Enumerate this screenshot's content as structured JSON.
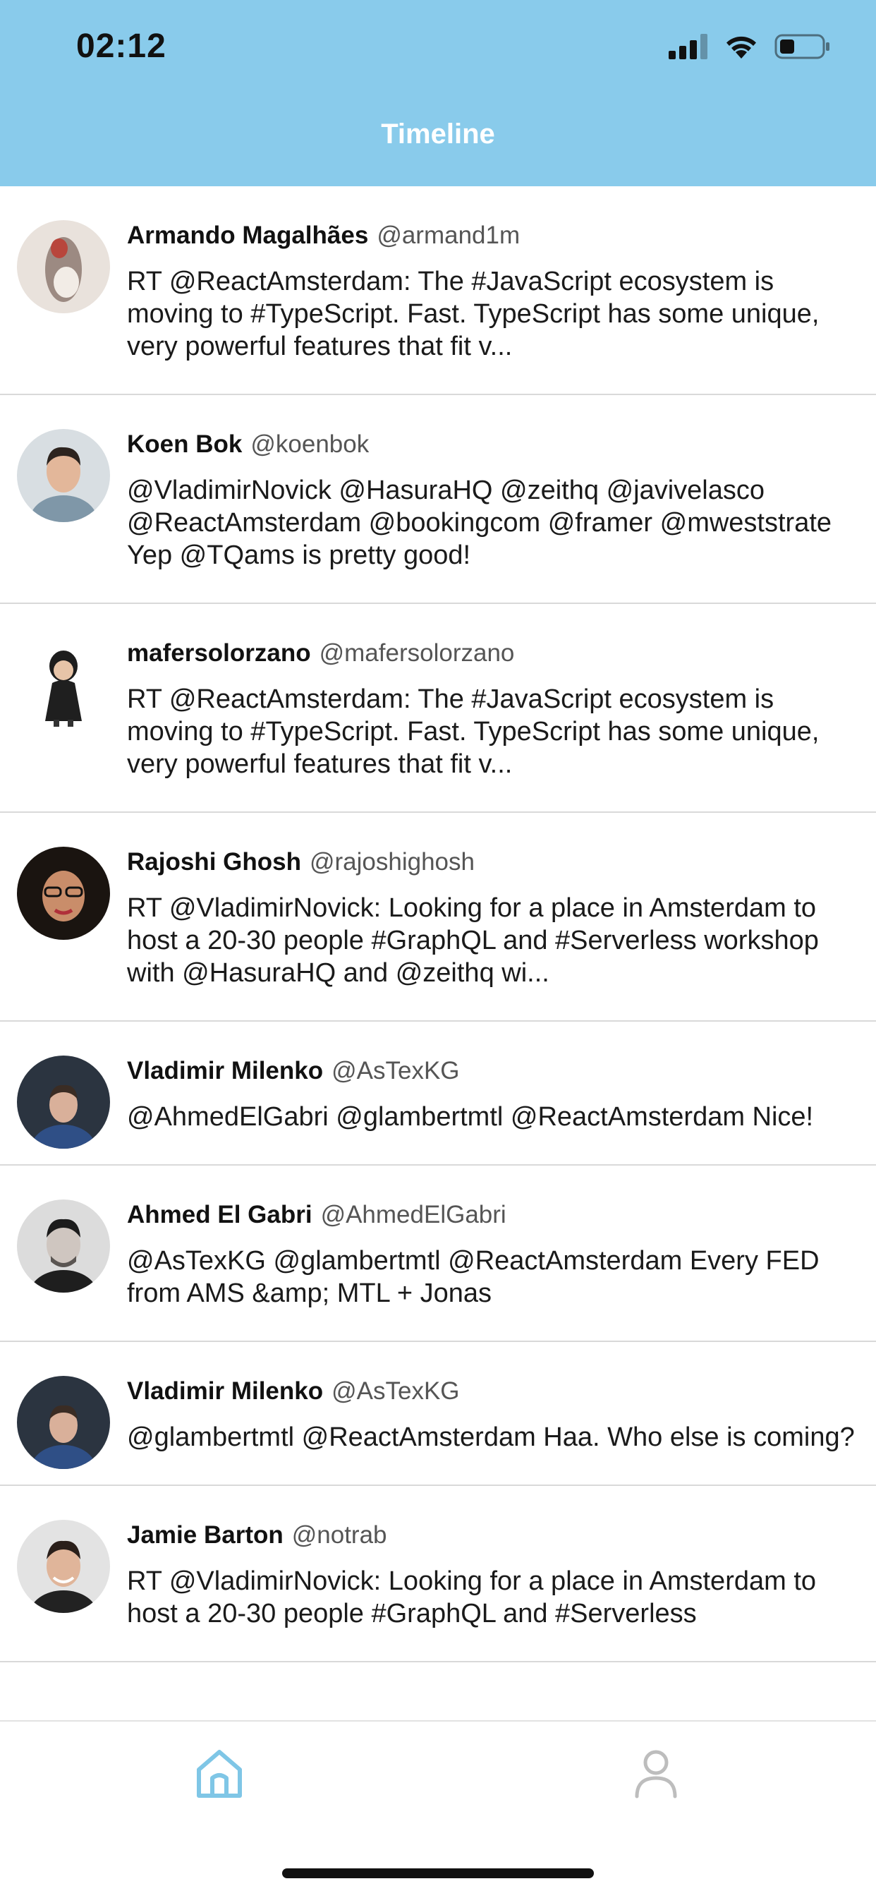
{
  "status_bar": {
    "time": "02:12"
  },
  "header": {
    "title": "Timeline"
  },
  "tweets": [
    {
      "author": "Armando Magalhães",
      "handle": "@armand1m",
      "text": "RT @ReactAmsterdam: The #JavaScript ecosystem is moving to #TypeScript. Fast. TypeScript has some unique, very powerful features that fit v..."
    },
    {
      "author": "Koen Bok",
      "handle": "@koenbok",
      "text": "@VladimirNovick @HasuraHQ @zeithq @javivelasco @ReactAmsterdam @bookingcom @framer @mweststrate Yep @TQams is pretty good!"
    },
    {
      "author": "mafersolorzano",
      "handle": "@mafersolorzano",
      "text": "RT @ReactAmsterdam: The #JavaScript ecosystem is moving to #TypeScript. Fast. TypeScript has some unique, very powerful features that fit v..."
    },
    {
      "author": "Rajoshi Ghosh",
      "handle": "@rajoshighosh",
      "text": "RT @VladimirNovick: Looking for a place in Amsterdam to host a 20-30 people #GraphQL and #Serverless workshop with @HasuraHQ and @zeithq wi..."
    },
    {
      "author": "Vladimir Milenko",
      "handle": "@AsTexKG",
      "text": "@AhmedElGabri @glambertmtl @ReactAmsterdam Nice!"
    },
    {
      "author": "Ahmed El Gabri",
      "handle": "@AhmedElGabri",
      "text": "@AsTexKG @glambertmtl @ReactAmsterdam Every FED from AMS &amp; MTL + Jonas"
    },
    {
      "author": "Vladimir Milenko",
      "handle": "@AsTexKG",
      "text": "@glambertmtl @ReactAmsterdam Haa. Who else is coming?"
    },
    {
      "author": "Jamie Barton",
      "handle": "@notrab",
      "text": "RT @VladimirNovick: Looking for a place in Amsterdam to host a 20-30 people #GraphQL and #Serverless"
    }
  ],
  "tab_bar": {
    "items": [
      "home-icon",
      "profile-icon"
    ],
    "active": "home"
  },
  "colors": {
    "header": "#89CBEB",
    "active_tab": "#7FC6E6",
    "inactive_tab": "#BDBDBD"
  }
}
